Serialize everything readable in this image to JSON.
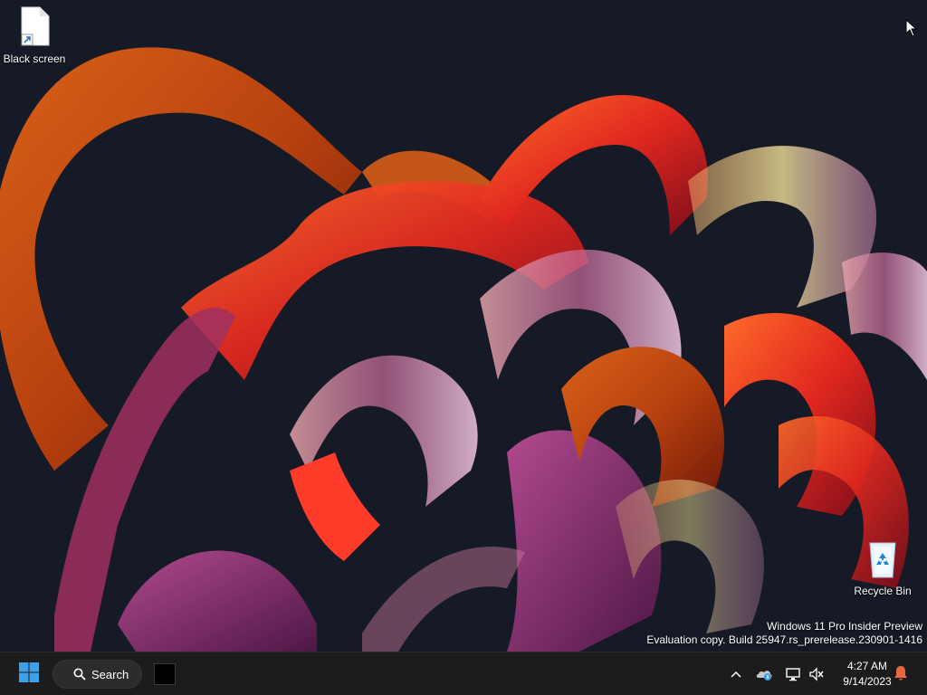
{
  "desktop": {
    "icons": [
      {
        "label": "Black screen",
        "icon": "shortcut-file-icon"
      },
      {
        "label": "Recycle Bin",
        "icon": "recycle-bin-icon"
      }
    ],
    "watermark": {
      "line1": "Windows 11 Pro Insider Preview",
      "line2": "Evaluation copy. Build 25947.rs_prerelease.230901-1416"
    }
  },
  "taskbar": {
    "start_icon": "windows-start-icon",
    "search_label": "Search",
    "pinned_app_icon": "black-window-icon",
    "tray": {
      "icons": [
        "chevron-up-icon",
        "onedrive-icon",
        "network-icon",
        "volume-muted-icon"
      ]
    },
    "clock": {
      "time": "4:27 AM",
      "date": "9/14/2023"
    },
    "notification_icon": "bell-icon"
  },
  "colors": {
    "desktop_bg": "#151a26",
    "taskbar_bg": "#1c1c1c",
    "accent": "#3ea0e8",
    "notification": "#e8673c"
  }
}
